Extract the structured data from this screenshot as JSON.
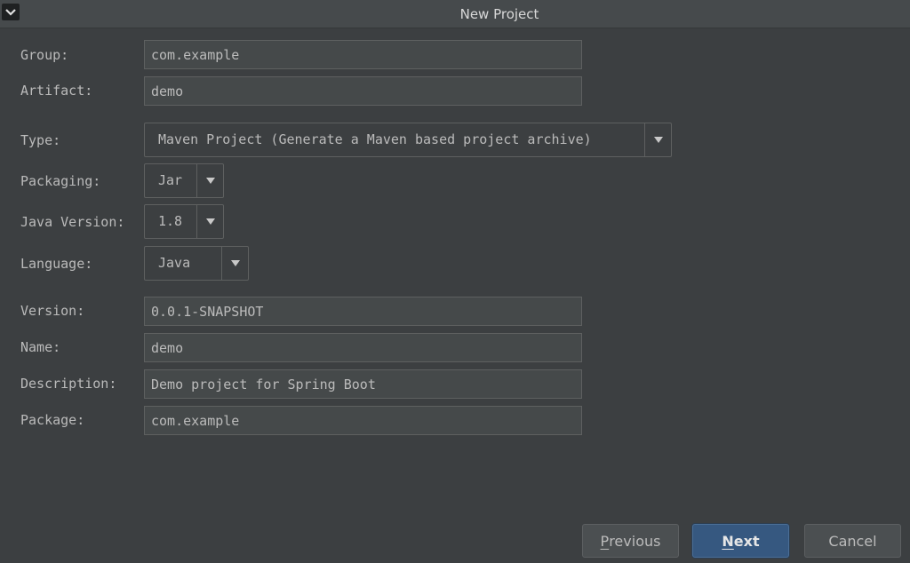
{
  "window": {
    "title": "New Project",
    "menu_icon": "chevron-down-icon"
  },
  "form": {
    "group": {
      "label": "Group:",
      "value": "com.example"
    },
    "artifact": {
      "label": "Artifact:",
      "value": "demo"
    },
    "type": {
      "label": "Type:",
      "value": "Maven Project (Generate a Maven based project archive)",
      "icon": "dropdown-arrow-icon"
    },
    "packaging": {
      "label": "Packaging:",
      "value": "Jar",
      "icon": "dropdown-arrow-icon"
    },
    "java_version": {
      "label": "Java Version:",
      "value": "1.8",
      "icon": "dropdown-arrow-icon"
    },
    "language": {
      "label": "Language:",
      "value": "Java",
      "icon": "dropdown-arrow-icon"
    },
    "version": {
      "label": "Version:",
      "value": "0.0.1-SNAPSHOT"
    },
    "name": {
      "label": "Name:",
      "value": "demo"
    },
    "description": {
      "label": "Description:",
      "value": "Demo project for Spring Boot"
    },
    "package": {
      "label": "Package:",
      "value": "com.example"
    }
  },
  "buttons": {
    "previous": {
      "mnemonic": "P",
      "rest": "revious"
    },
    "next": {
      "mnemonic": "N",
      "rest": "ext"
    },
    "cancel": {
      "label": "Cancel"
    }
  },
  "colors": {
    "background": "#3c3f41",
    "field_background": "#45494a",
    "text": "#bbbbbb",
    "default_button": "#365880"
  }
}
